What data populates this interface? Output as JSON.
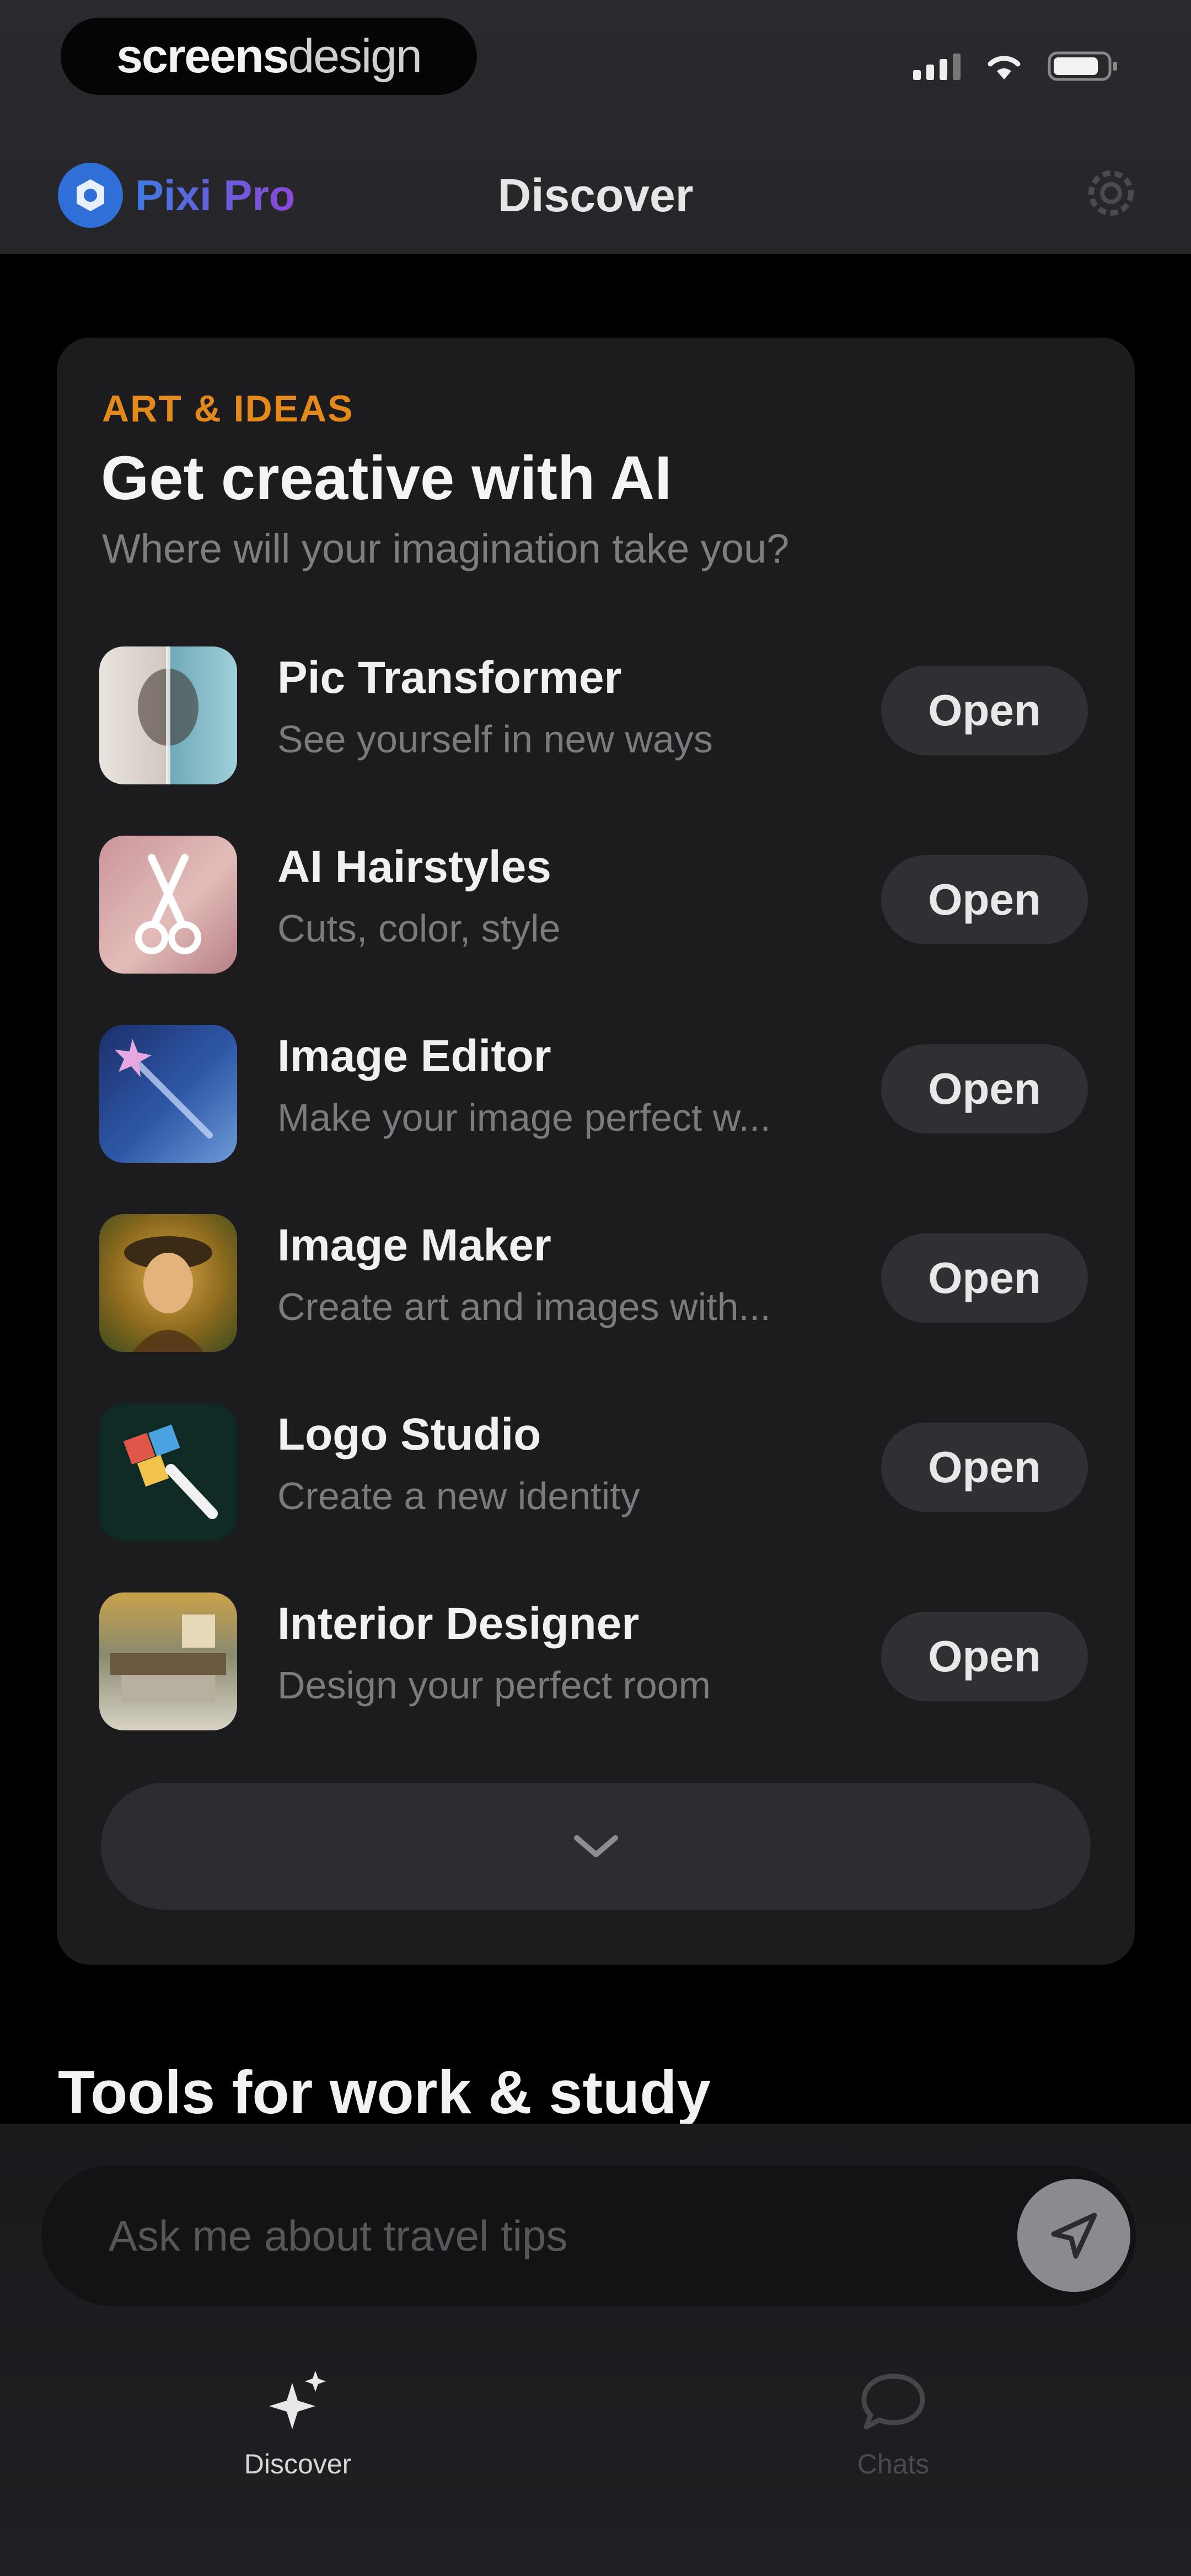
{
  "status_bar": {
    "brand_bold": "screens",
    "brand_light": "design"
  },
  "nav": {
    "pro_label": "Pixi Pro",
    "title": "Discover"
  },
  "card": {
    "eyebrow": "ART & IDEAS",
    "title": "Get creative with AI",
    "subtitle": "Where will your imagination take you?",
    "tools": [
      {
        "name": "Pic Transformer",
        "desc": "See yourself in new ways",
        "action": "Open",
        "icon": "portrait-split-icon"
      },
      {
        "name": "AI Hairstyles",
        "desc": "Cuts, color, style",
        "action": "Open",
        "icon": "scissors-icon"
      },
      {
        "name": "Image Editor",
        "desc": "Make your image perfect w...",
        "action": "Open",
        "icon": "magic-wand-icon"
      },
      {
        "name": "Image Maker",
        "desc": "Create art and images with...",
        "action": "Open",
        "icon": "painted-portrait-icon"
      },
      {
        "name": "Logo Studio",
        "desc": "Create a new identity",
        "action": "Open",
        "icon": "paintbrush-icon"
      },
      {
        "name": "Interior Designer",
        "desc": "Design your perfect room",
        "action": "Open",
        "icon": "room-icon"
      }
    ]
  },
  "section": {
    "title": "Tools for work & study"
  },
  "composer": {
    "placeholder": "Ask me about travel tips"
  },
  "tabs": {
    "discover": "Discover",
    "chats": "Chats"
  },
  "colors": {
    "accent_orange": "#e48a1c",
    "pixi_blue": "#3f7ae0",
    "pixi_purple": "#8a48d8"
  }
}
